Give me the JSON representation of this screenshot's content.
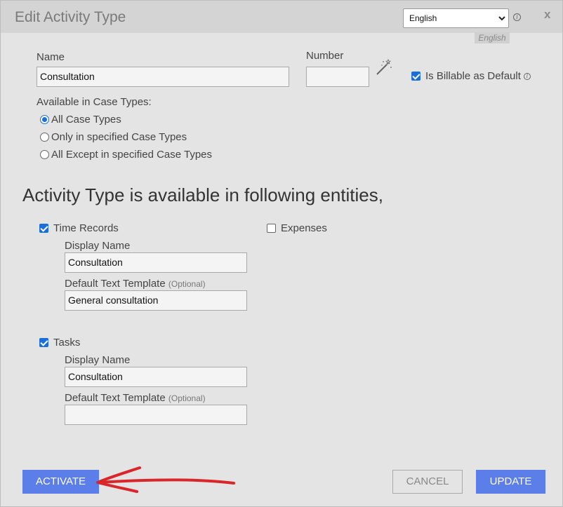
{
  "dialog": {
    "title": "Edit Activity Type",
    "close_label": "x",
    "language": {
      "selected": "English",
      "tag": "English"
    }
  },
  "form": {
    "name_label": "Name",
    "name_value": "Consultation",
    "number_label": "Number",
    "number_value": "",
    "billable_label": "Is Billable as Default",
    "billable_checked": true,
    "case_types_label": "Available in Case Types:",
    "case_type_options": [
      {
        "label": "All Case Types",
        "selected": true
      },
      {
        "label": "Only in specified Case Types",
        "selected": false
      },
      {
        "label": "All Except in specified Case Types",
        "selected": false
      }
    ]
  },
  "entities": {
    "heading": "Activity Type is available in following entities,",
    "time_records": {
      "label": "Time Records",
      "checked": true,
      "display_name_label": "Display Name",
      "display_name_value": "Consultation",
      "template_label": "Default Text Template",
      "optional_label": "(Optional)",
      "template_value": "General consultation"
    },
    "expenses": {
      "label": "Expenses",
      "checked": false
    },
    "tasks": {
      "label": "Tasks",
      "checked": true,
      "display_name_label": "Display Name",
      "display_name_value": "Consultation",
      "template_label": "Default Text Template",
      "optional_label": "(Optional)",
      "template_value": ""
    }
  },
  "buttons": {
    "activate": "ACTIVATE",
    "cancel": "CANCEL",
    "update": "UPDATE"
  },
  "colors": {
    "primary_button": "#5b7ee8",
    "checkbox_accent": "#1a6fd8",
    "annotation_arrow": "#d9262b"
  }
}
